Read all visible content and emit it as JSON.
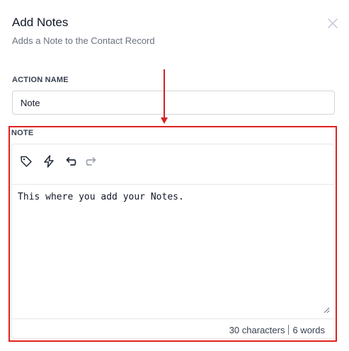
{
  "modal": {
    "title": "Add Notes",
    "subtitle": "Adds a Note to the Contact Record"
  },
  "action_name": {
    "label": "ACTION NAME",
    "value": "Note"
  },
  "note": {
    "label": "NOTE",
    "text": "This where you add your Notes.",
    "characters": "30 characters",
    "words": "6 words"
  },
  "toolbar": {
    "icons": [
      "tag-icon",
      "lightning-icon",
      "undo-icon",
      "redo-icon"
    ]
  },
  "colors": {
    "highlight": "#e02020",
    "arrow": "#d42020",
    "border": "#d1d5db"
  }
}
